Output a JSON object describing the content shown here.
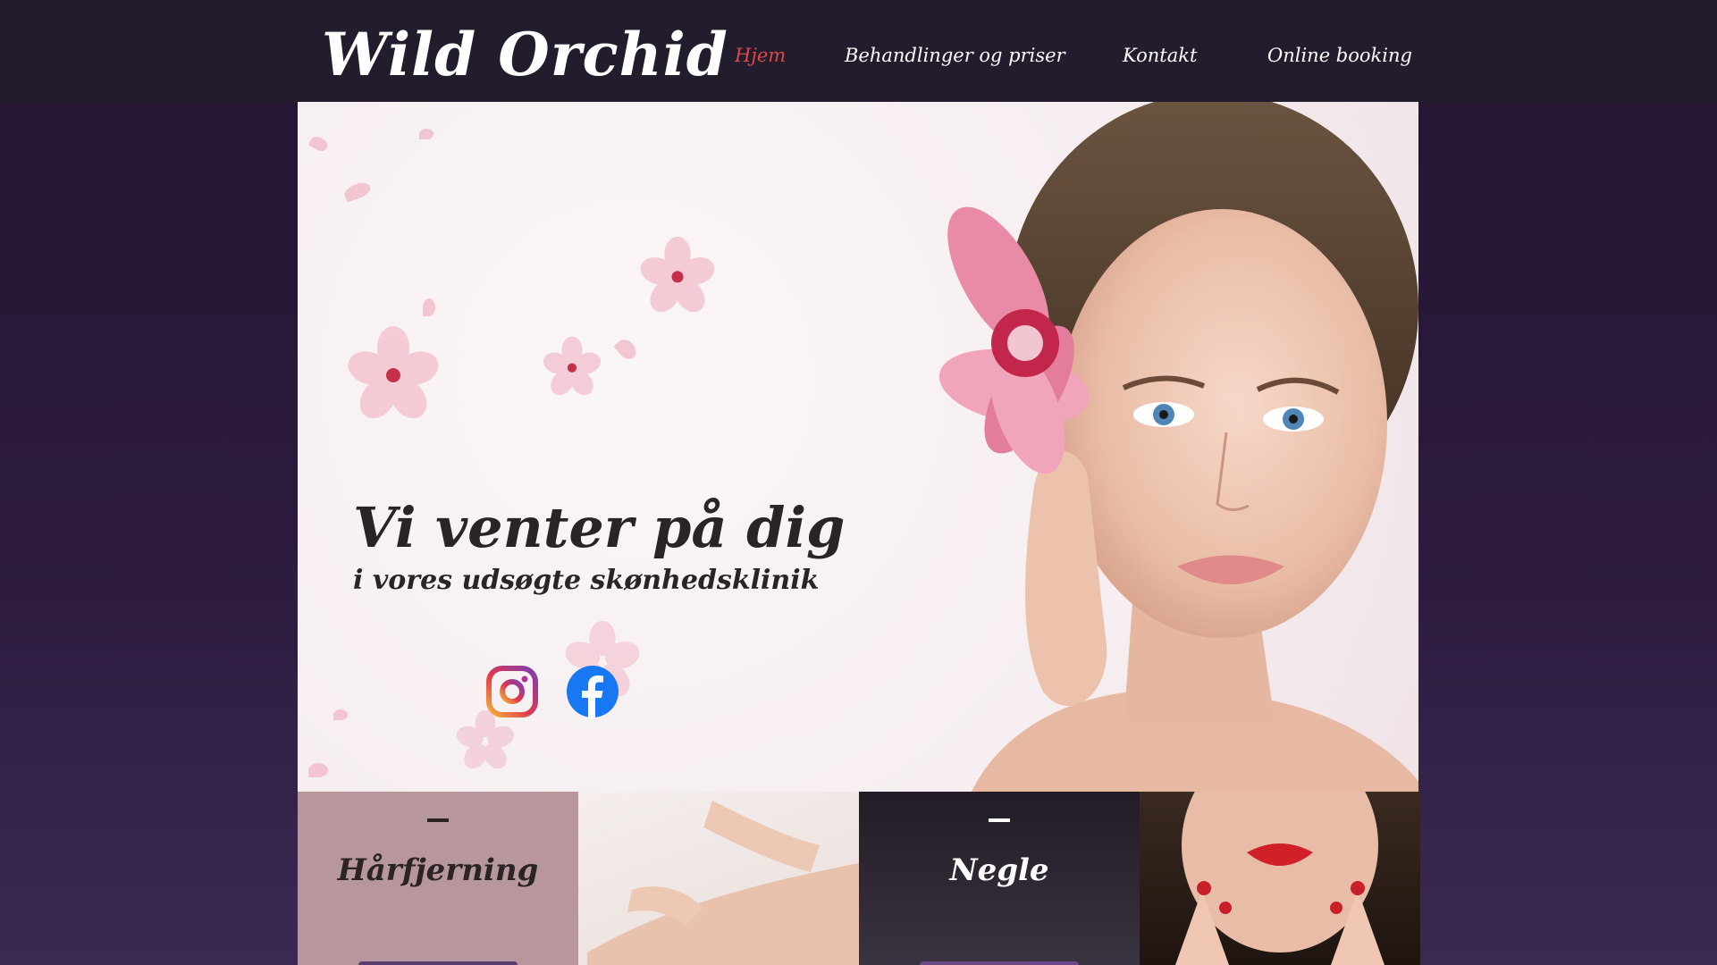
{
  "brand": {
    "logo": "Wild Orchid"
  },
  "nav": {
    "items": [
      {
        "label": "Hjem",
        "active": true
      },
      {
        "label": "Behandlinger og priser",
        "active": false
      },
      {
        "label": "Kontakt",
        "active": false
      },
      {
        "label": "Online booking",
        "active": false
      }
    ]
  },
  "hero": {
    "headline": "Vi venter på dig",
    "subline": "i vores udsøgte skønhedsklinik",
    "social": [
      "instagram-icon",
      "facebook-icon"
    ]
  },
  "tiles": [
    {
      "label": "Hårfjerning",
      "dash": "—"
    },
    {
      "label": "",
      "image": "waxing-arm"
    },
    {
      "label": "Negle",
      "dash": "—"
    },
    {
      "label": "",
      "image": "red-lips-nails"
    }
  ],
  "colors": {
    "nav_bg": "#221c2d",
    "active_nav": "#e0484a",
    "tile1_bg": "#b8979c",
    "tile3_bg": "#2b2631",
    "button": "#5a3f6e"
  }
}
